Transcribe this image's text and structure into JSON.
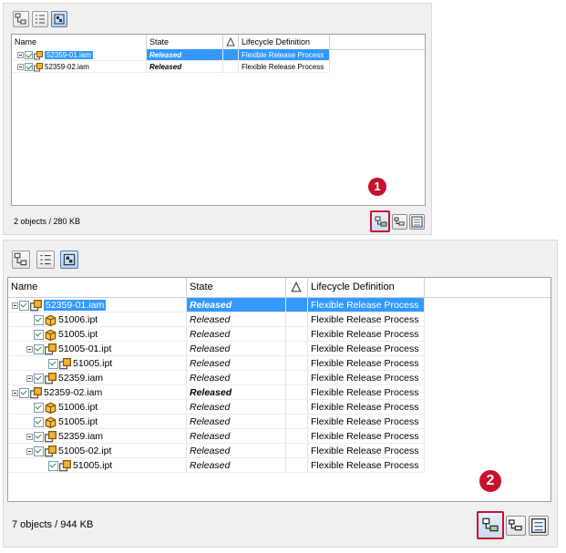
{
  "top": {
    "columns": [
      "Name",
      "State",
      "Lifecycle Definition"
    ],
    "rows": [
      {
        "name": "52359-01.iam",
        "state": "Released",
        "lifecycle": "Flexible Release Process",
        "selected": true
      },
      {
        "name": "52359-02.iam",
        "state": "Released",
        "lifecycle": "Flexible Release Process",
        "selected": false
      }
    ],
    "status": "2 objects / 280 KB",
    "badge": "1"
  },
  "bottom": {
    "columns": [
      "Name",
      "State",
      "Lifecycle Definition"
    ],
    "rows": [
      {
        "name": "52359-01.iam",
        "state": "Released",
        "lifecycle": "Flexible Release Process",
        "level": 0,
        "icon": "assembly-icon",
        "bold": true,
        "selected": true
      },
      {
        "name": "51006.ipt",
        "state": "Released",
        "lifecycle": "Flexible Release Process",
        "level": 1,
        "icon": "part-icon"
      },
      {
        "name": "51005.ipt",
        "state": "Released",
        "lifecycle": "Flexible Release Process",
        "level": 1,
        "icon": "part-icon"
      },
      {
        "name": "51005-01.ipt",
        "state": "Released",
        "lifecycle": "Flexible Release Process",
        "level": 1,
        "icon": "assembly-icon"
      },
      {
        "name": "51005.ipt",
        "state": "Released",
        "lifecycle": "Flexible Release Process",
        "level": 2,
        "icon": "assembly-icon"
      },
      {
        "name": "52359.iam",
        "state": "Released",
        "lifecycle": "Flexible Release Process",
        "level": 1,
        "icon": "assembly-icon"
      },
      {
        "name": "52359-02.iam",
        "state": "Released",
        "lifecycle": "Flexible Release Process",
        "level": 0,
        "icon": "assembly-icon",
        "bold": true
      },
      {
        "name": "51006.ipt",
        "state": "Released",
        "lifecycle": "Flexible Release Process",
        "level": 1,
        "icon": "part-icon"
      },
      {
        "name": "51005.ipt",
        "state": "Released",
        "lifecycle": "Flexible Release Process",
        "level": 1,
        "icon": "part-icon"
      },
      {
        "name": "52359.iam",
        "state": "Released",
        "lifecycle": "Flexible Release Process",
        "level": 1,
        "icon": "assembly-icon"
      },
      {
        "name": "51005-02.ipt",
        "state": "Released",
        "lifecycle": "Flexible Release Process",
        "level": 1,
        "icon": "assembly-icon"
      },
      {
        "name": "51005.ipt",
        "state": "Released",
        "lifecycle": "Flexible Release Process",
        "level": 2,
        "icon": "assembly-icon"
      }
    ],
    "status": "7 objects / 944 KB",
    "badge": "2"
  },
  "colors": {
    "selection": "#3399ff",
    "highlight": "#c8102e"
  }
}
